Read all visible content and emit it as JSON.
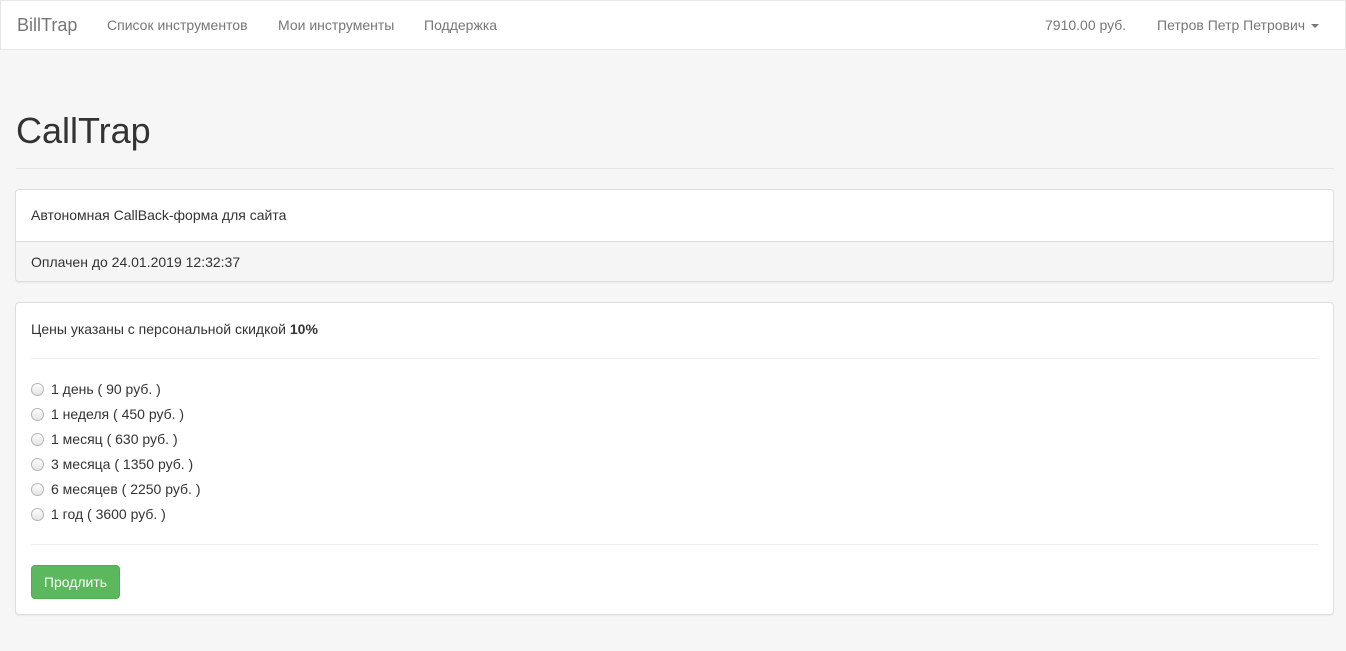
{
  "navbar": {
    "brand": "BillTrap",
    "links": [
      "Список инструментов",
      "Мои инструменты",
      "Поддержка"
    ],
    "balance": "7910.00 руб.",
    "user": "Петров Петр Петрович"
  },
  "page": {
    "title": "CallTrap"
  },
  "tool_panel": {
    "description": "Автономная CallBack-форма для сайта",
    "paid_until": "Оплачен до 24.01.2019 12:32:37"
  },
  "pricing_panel": {
    "discount_prefix": "Цены указаны с персональной скидкой",
    "discount_value": "10%",
    "options": [
      "1 день ( 90 руб. )",
      "1 неделя ( 450 руб. )",
      "1 месяц ( 630 руб. )",
      "3 месяца ( 1350 руб. )",
      "6 месяцев ( 2250 руб. )",
      "1 год ( 3600 руб. )"
    ],
    "submit_label": "Продлить"
  },
  "colors": {
    "accent_button": "#5cb85c",
    "navbar_bg": "#ffffff",
    "page_bg": "#f6f6f6"
  },
  "icons": [
    "caret-down-icon",
    "radio-icon"
  ]
}
